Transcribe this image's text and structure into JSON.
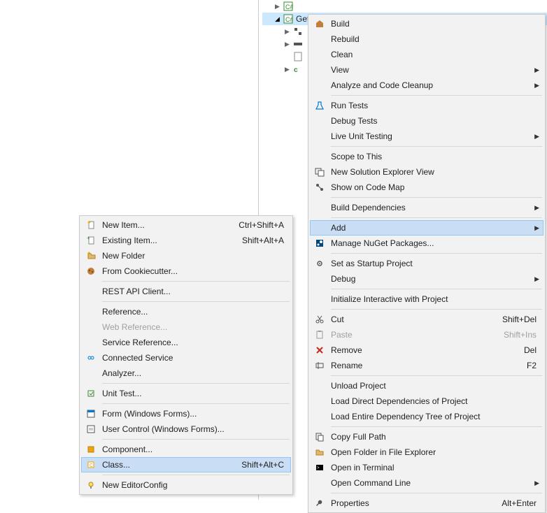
{
  "tree": {
    "selected_label": "GetSymbolSwatchTests"
  },
  "mainmenu": {
    "items": [
      {
        "label": "Build",
        "icon": "build"
      },
      {
        "label": "Rebuild"
      },
      {
        "label": "Clean"
      },
      {
        "label": "View",
        "arrow": true
      },
      {
        "label": "Analyze and Code Cleanup",
        "arrow": true
      }
    ],
    "group2": [
      {
        "label": "Run Tests",
        "icon": "flask"
      },
      {
        "label": "Debug Tests"
      },
      {
        "label": "Live Unit Testing",
        "arrow": true
      }
    ],
    "group3": [
      {
        "label": "Scope to This"
      },
      {
        "label": "New Solution Explorer View",
        "icon": "new-view"
      },
      {
        "label": "Show on Code Map",
        "icon": "codemap"
      }
    ],
    "group4": [
      {
        "label": "Build Dependencies",
        "arrow": true
      }
    ],
    "group5": [
      {
        "label": "Add",
        "arrow": true,
        "highlighted": true
      },
      {
        "label": "Manage NuGet Packages...",
        "icon": "nuget"
      }
    ],
    "group6": [
      {
        "label": "Set as Startup Project",
        "icon": "gear"
      },
      {
        "label": "Debug",
        "arrow": true
      }
    ],
    "group7": [
      {
        "label": "Initialize Interactive with Project"
      }
    ],
    "group8": [
      {
        "label": "Cut",
        "icon": "cut",
        "shortcut": "Shift+Del"
      },
      {
        "label": "Paste",
        "icon": "paste",
        "shortcut": "Shift+Ins",
        "disabled": true
      },
      {
        "label": "Remove",
        "icon": "remove",
        "shortcut": "Del"
      },
      {
        "label": "Rename",
        "icon": "rename",
        "shortcut": "F2"
      }
    ],
    "group9": [
      {
        "label": "Unload Project"
      },
      {
        "label": "Load Direct Dependencies of Project"
      },
      {
        "label": "Load Entire Dependency Tree of Project"
      }
    ],
    "group10": [
      {
        "label": "Copy Full Path",
        "icon": "copy"
      },
      {
        "label": "Open Folder in File Explorer",
        "icon": "folder"
      },
      {
        "label": "Open in Terminal",
        "icon": "terminal"
      },
      {
        "label": "Open Command Line",
        "arrow": true
      }
    ],
    "group11": [
      {
        "label": "Properties",
        "icon": "wrench",
        "shortcut": "Alt+Enter"
      }
    ]
  },
  "submenu": {
    "group1": [
      {
        "label": "New Item...",
        "icon": "new-item",
        "shortcut": "Ctrl+Shift+A"
      },
      {
        "label": "Existing Item...",
        "icon": "existing-item",
        "shortcut": "Shift+Alt+A"
      },
      {
        "label": "New Folder",
        "icon": "new-folder"
      },
      {
        "label": "From Cookiecutter...",
        "icon": "cookie"
      }
    ],
    "group2": [
      {
        "label": "REST API Client..."
      }
    ],
    "group3": [
      {
        "label": "Reference..."
      },
      {
        "label": "Web Reference...",
        "disabled": true
      },
      {
        "label": "Service Reference..."
      },
      {
        "label": "Connected Service",
        "icon": "connected"
      },
      {
        "label": "Analyzer..."
      }
    ],
    "group4": [
      {
        "label": "Unit Test...",
        "icon": "unit-test"
      }
    ],
    "group5": [
      {
        "label": "Form (Windows Forms)...",
        "icon": "form"
      },
      {
        "label": "User Control (Windows Forms)...",
        "icon": "usercontrol"
      }
    ],
    "group6": [
      {
        "label": "Component...",
        "icon": "component"
      },
      {
        "label": "Class...",
        "icon": "class",
        "shortcut": "Shift+Alt+C",
        "highlighted": true
      }
    ],
    "group7": [
      {
        "label": "New EditorConfig",
        "icon": "bulb"
      }
    ]
  }
}
